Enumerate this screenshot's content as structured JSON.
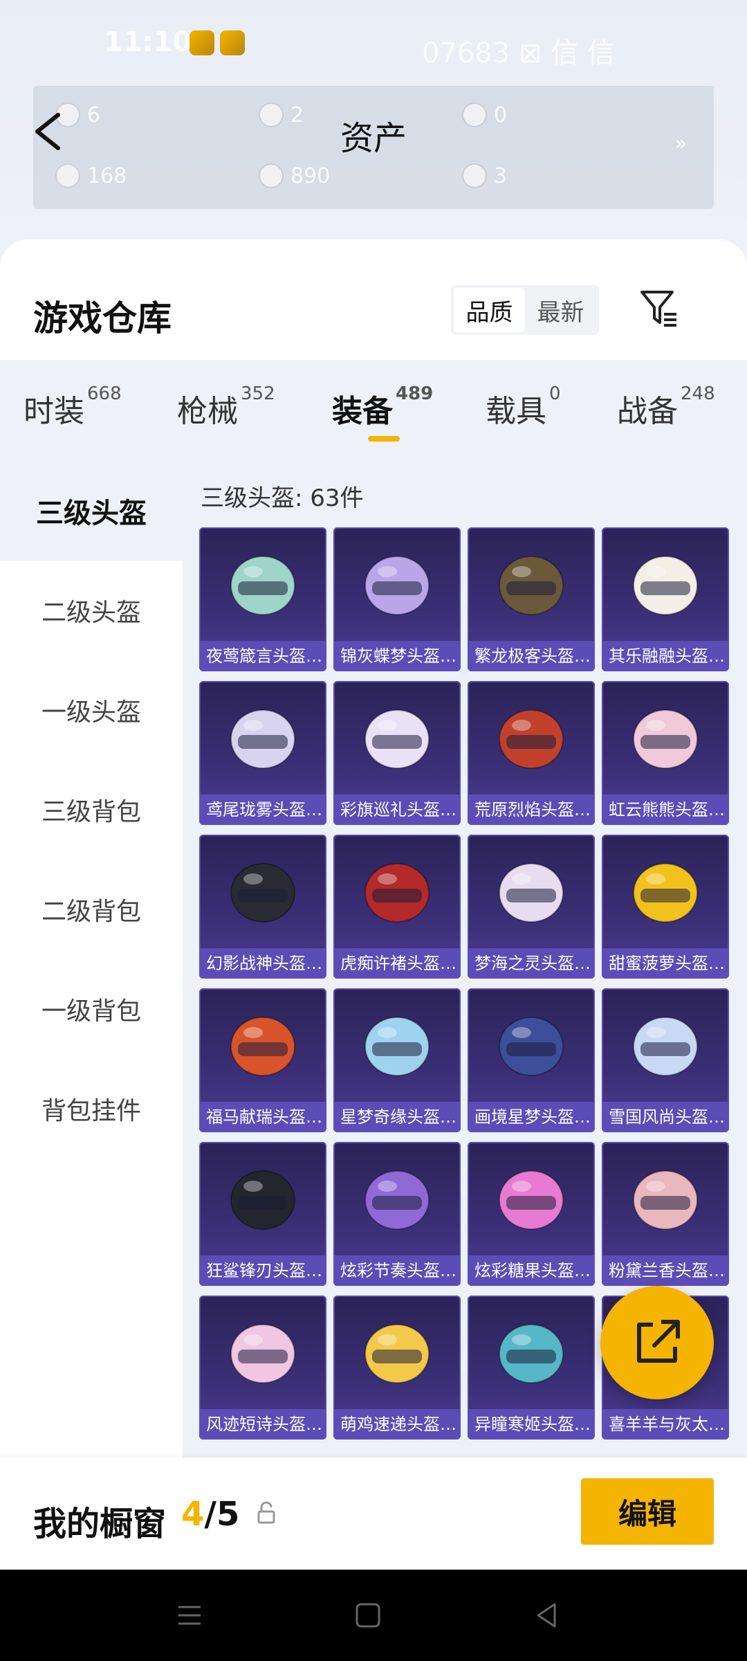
{
  "status": {
    "time": "11:10",
    "network": "07683 ⊠ 信 信"
  },
  "assets": {
    "title": "资产",
    "items": [
      {
        "value": "6"
      },
      {
        "value": "2"
      },
      {
        "value": "0"
      },
      {
        "value": "168"
      },
      {
        "value": "890"
      },
      {
        "value": "3"
      }
    ],
    "more": "»"
  },
  "warehouse": {
    "title": "游戏仓库",
    "sort_quality": "品质",
    "sort_newest": "最新"
  },
  "tabs": [
    {
      "label": "时装",
      "count": "668"
    },
    {
      "label": "枪械",
      "count": "352"
    },
    {
      "label": "装备",
      "count": "489"
    },
    {
      "label": "载具",
      "count": "0"
    },
    {
      "label": "战备",
      "count": "248"
    }
  ],
  "sidebar": {
    "items": [
      {
        "label": "三级头盔"
      },
      {
        "label": "二级头盔"
      },
      {
        "label": "一级头盔"
      },
      {
        "label": "三级背包"
      },
      {
        "label": "二级背包"
      },
      {
        "label": "一级背包"
      },
      {
        "label": "背包挂件"
      }
    ]
  },
  "content": {
    "count_label": "三级头盔: 63件",
    "items": [
      {
        "name": "夜莺箴言头盔…",
        "color": "#9fd4c8"
      },
      {
        "name": "锦灰蝶梦头盔…",
        "color": "#b9a6e8"
      },
      {
        "name": "繁龙极客头盔…",
        "color": "#6b5a3a"
      },
      {
        "name": "其乐融融头盔…",
        "color": "#f3efe6"
      },
      {
        "name": "鸢尾珑雾头盔…",
        "color": "#d8d4ef"
      },
      {
        "name": "彩旗巡礼头盔…",
        "color": "#e9e1f6"
      },
      {
        "name": "荒原烈焰头盔…",
        "color": "#c2412c"
      },
      {
        "name": "虹云熊熊头盔…",
        "color": "#f0c9da"
      },
      {
        "name": "幻影战神头盔…",
        "color": "#2a2a33"
      },
      {
        "name": "虎痴许褚头盔…",
        "color": "#b42a2a"
      },
      {
        "name": "梦海之灵头盔…",
        "color": "#e7dcf0"
      },
      {
        "name": "甜蜜菠萝头盔…",
        "color": "#f2c21c"
      },
      {
        "name": "福马献瑞头盔…",
        "color": "#d9542a"
      },
      {
        "name": "星梦奇缘头盔…",
        "color": "#9fd2ef"
      },
      {
        "name": "画境星梦头盔…",
        "color": "#3d4f9a"
      },
      {
        "name": "雪国风尚头盔…",
        "color": "#c8d8f5"
      },
      {
        "name": "狂鲨锋刃头盔…",
        "color": "#25252e"
      },
      {
        "name": "炫彩节奏头盔…",
        "color": "#8f6ad6"
      },
      {
        "name": "炫彩糖果头盔…",
        "color": "#e77bd1"
      },
      {
        "name": "粉黛兰香头盔…",
        "color": "#e9b7bd"
      },
      {
        "name": "风迹短诗头盔…",
        "color": "#f0c6e2"
      },
      {
        "name": "萌鸡速递头盔…",
        "color": "#f3c94a"
      },
      {
        "name": "异瞳寒姬头盔…",
        "color": "#56b7c9"
      },
      {
        "name": "喜羊羊与灰太…",
        "color": "#f0f0f0"
      }
    ]
  },
  "showcase": {
    "label": "我的橱窗",
    "current": "4",
    "total": "/5",
    "edit_label": "编辑"
  },
  "colors": {
    "accent": "#f5b400",
    "card_bg": "#3b2f77"
  }
}
